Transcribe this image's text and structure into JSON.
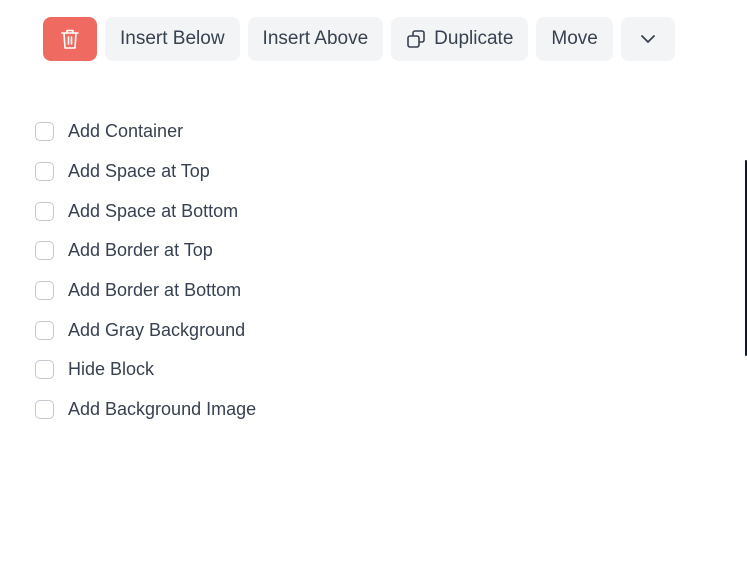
{
  "toolbar": {
    "delete_icon": "trash-icon",
    "insert_below_label": "Insert Below",
    "insert_above_label": "Insert Above",
    "duplicate_icon": "duplicate-icon",
    "duplicate_label": "Duplicate",
    "move_label": "Move",
    "more_icon": "chevron-down-icon",
    "delete_color": "#ef6b62",
    "button_color": "#f3f4f6"
  },
  "options": [
    {
      "label": "Add Container",
      "checked": false
    },
    {
      "label": "Add Space at Top",
      "checked": false
    },
    {
      "label": "Add Space at Bottom",
      "checked": false
    },
    {
      "label": "Add Border at Top",
      "checked": false
    },
    {
      "label": "Add Border at Bottom",
      "checked": false
    },
    {
      "label": "Add Gray Background",
      "checked": false
    },
    {
      "label": "Hide Block",
      "checked": false
    },
    {
      "label": "Add Background Image",
      "checked": false
    }
  ]
}
